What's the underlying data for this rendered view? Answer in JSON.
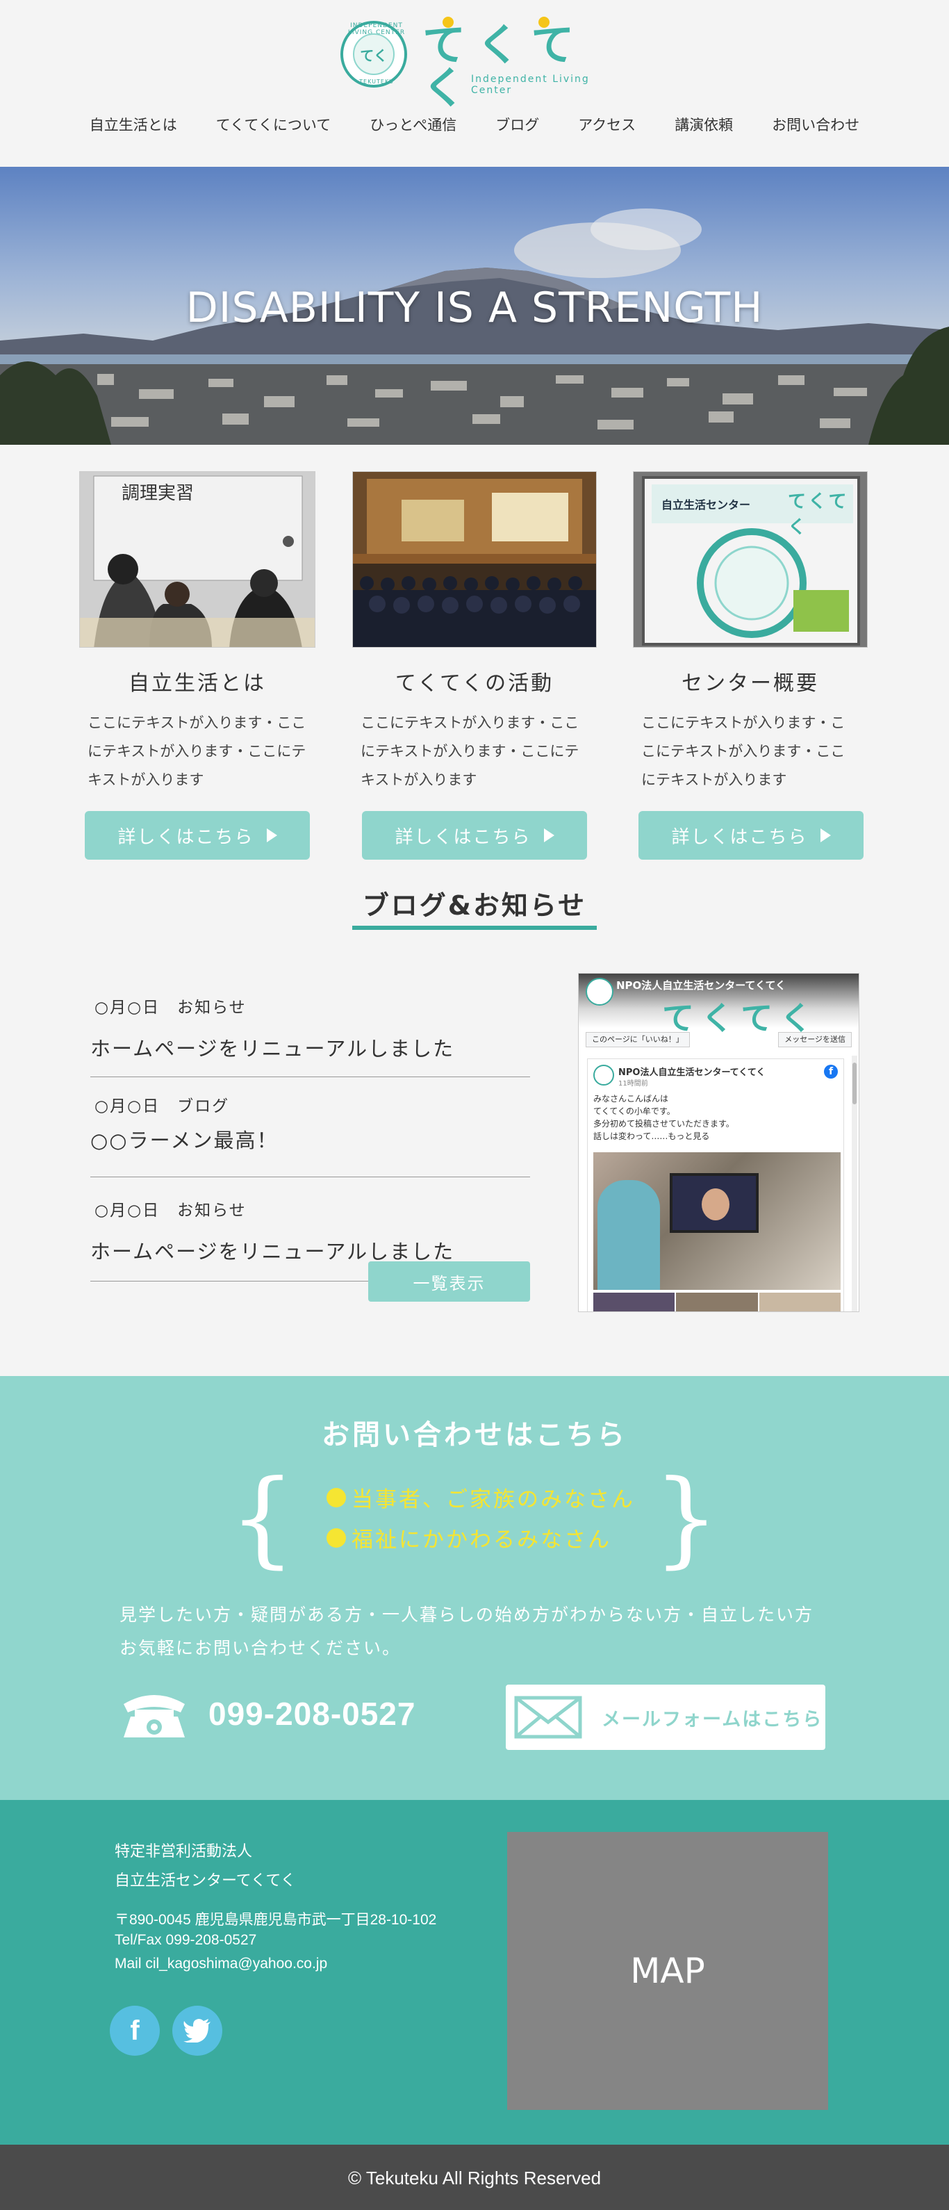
{
  "brand": {
    "name": "てくてく",
    "subtitle": "Independent Living Center",
    "ring_top": "INDEPENDENT LIVING CENTER",
    "ring_bottom": "TEKUTEKU",
    "mark": "てく"
  },
  "nav": {
    "items": [
      {
        "label": "自立生活とは"
      },
      {
        "label": "てくてくについて"
      },
      {
        "label": "ひっとぺ通信"
      },
      {
        "label": "ブログ"
      },
      {
        "label": "アクセス"
      },
      {
        "label": "講演依頼"
      },
      {
        "label": "お問い合わせ"
      }
    ]
  },
  "hero": {
    "title": "DISABILITY IS A STRENGTH"
  },
  "features": [
    {
      "title": "自立生活とは",
      "text": "ここにテキストが入ります・ここにテキストが入ります・ここにテキストが入ります",
      "button": "詳しくはこちら",
      "image_caption": "調理実習"
    },
    {
      "title": "てくてくの活動",
      "text": "ここにテキストが入ります・ここにテキストが入ります・ここにテキストが入ります",
      "button": "詳しくはこちら"
    },
    {
      "title": "センター概要",
      "text": "ここにテキストが入ります・ここにテキストが入ります・ここにテキストが入ります",
      "button": "詳しくはこちら",
      "sign_heading": "自立生活センター",
      "sign_brand": "てくてく"
    }
  ],
  "blog": {
    "heading": "ブログ&お知らせ",
    "items": [
      {
        "meta": "○月○日　お知らせ",
        "title": "ホームページをリニューアルしました"
      },
      {
        "meta": "○月○日　ブログ",
        "title": "○○ラーメン最高！"
      },
      {
        "meta": "○月○日　お知らせ",
        "title": "ホームページをリニューアルしました"
      }
    ],
    "list_button": "一覧表示"
  },
  "facebook": {
    "page_name": "NPO法人自立生活センターてくてく",
    "cover_text": "てくてく",
    "like_label": "このページに「いいね！」",
    "message_label": "メッセージを送信",
    "post_name": "NPO法人自立生活センターてくてく",
    "post_date": "11時間前",
    "post_text": "みなさんこんばんは\nてくてくの小牟です。\n多分初めて投稿させていただきます。\n話しは変わって……もっと見る"
  },
  "contact": {
    "title": "お問い合わせはこちら",
    "targets": [
      "当事者、ご家族のみなさん",
      "福祉にかかわるみなさん"
    ],
    "line1": "見学したい方・疑問がある方・一人暮らしの始め方がわからない方・自立したい方",
    "line2": "お気軽にお問い合わせください。",
    "phone": "099-208-0527",
    "mail_button": "メールフォームはこちら",
    "brace_left": "{",
    "brace_right": "}"
  },
  "footer": {
    "org_type": "特定非営利活動法人",
    "org_name": "自立生活センターてくてく",
    "address": "〒890-0045 鹿児島県鹿児島市武一丁目28-10-102",
    "tel": "Tel/Fax 099-208-0527",
    "mail": "Mail cil_kagoshima@yahoo.co.jp",
    "map_label": "MAP",
    "facebook_glyph": "f",
    "twitter_glyph": "t"
  },
  "copyright": "© Tekuteku All Rights Reserved",
  "colors": {
    "accent": "#3aab9e",
    "light_accent": "#8fd5cc",
    "highlight": "#f5e532",
    "footer_bottom": "#4b4b4b"
  }
}
